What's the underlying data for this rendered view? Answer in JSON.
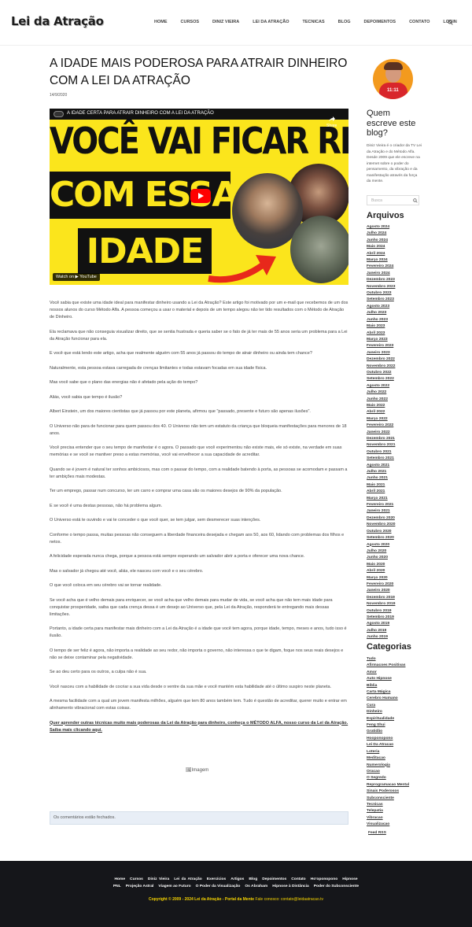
{
  "site": {
    "logo": "Lei da Atração"
  },
  "nav": {
    "items": [
      "HOME",
      "CURSOS",
      "DINIZ VIEIRA",
      "LEI DA ATRAÇÃO",
      "TECNICAS",
      "BLOG",
      "DEPOIMENTOS",
      "CONTATO",
      "LOGIN"
    ]
  },
  "post": {
    "title": "A IDADE MAIS PODEROSA PARA ATRAIR DINHEIRO COM A LEI DA ATRAÇÃO",
    "date": "14/9/2020",
    "video": {
      "title": "A IDADE CERTA PARA ATRAIR DINHEIRO COM A LEI DA ATRAÇÃO",
      "share": "Share",
      "line1": "VOCÊ VAI FICAR RICO",
      "line2": "COM ESSA",
      "line3": "IDADE",
      "watch": "Watch on ▶ YouTube"
    },
    "paragraphs": [
      "Você sabia que existe uma idade ideal para manifestar dinheiro usando a Lei da Atração? Este artigo foi motivado por um e-mail que recebemos de um dos nossos alunos do curso Método Alfa. A pessoa começou a usar o material e depois de um tempo alegou não ter tido resultados com o Método de Atração de Dinheiro.",
      "Ela reclamava que não conseguia visualizar direito, que se sentia frustrada e queria saber se o fato de já ter mais de 55 anos seria um problema para a Lei da Atração funcionar para ela.",
      "E você que está lendo este artigo, acha que realmente alguém com 55 anos já passou do tempo de atrair dinheiro ou ainda tem chance?",
      "Naturalmente, esta pessoa estava carregada de crenças limitantes e todas estavam focadas em sua idade física.",
      "Mas você sabe que o plano das energias não é afetado pela ação do tempo?",
      "Aliás, você sabia que tempo é ilusão?",
      "Albert Einstein, um dos maiores cientistas que já passou por este planeta, afirmou que \"passado, presente e futuro são apenas ilusões\".",
      "O Universo não para de funcionar para quem passou dos 40. O Universo não tem um estatuto da criança que bloqueia manifestações para menores de 18 anos.",
      "Você precisa entender que o seu tempo de manifestar é o agora. O passado que você experimentou não existe mais, ele só existe, na verdade em suas memórias e se você se mantiver preso a estas memórias, você vai envelhecer a sua capacidade de acreditar.",
      "Quando se é jovem é natural ter sonhos ambiciosos, mas com o passar do tempo, com a realidade batendo à porta, as pessoas se acomodam e passam a ter ambições mais modestas.",
      "Ter um emprego, passar num concurso, ter um carro e comprar uma casa são os maiores desejos de 90% da população.",
      "E se você é uma destas pessoas, não há problema algum.",
      "O Universo está te ouvindo e vai te conceder o que você quer, se tem julgar, sem desmerecer suas intenções.",
      "Conforme o tempo passa, muitas pessoas não conseguem a liberdade financeira desejada e chegam aos 50, aos 60, lidando com problemas dos filhos e netos.",
      "A felicidade esperada nunca chega, porque a pessoa está sempre esperando um salvador abrir a porta e oferecer uma nova chance.",
      "Mas o salvador já chegou até você, aliás, ele nasceu com você e o seu cérebro.",
      "O que você coloca em seu cérebro vai se tornar realidade.",
      "Se você acha que é velho demais para enriquecer, se você acha que velho demais para mudar de vida, se você acha que não tem mais idade para conquistar prosperidade, saiba que cada crença dessa é um desejo ao Universo que, pela Lei da Atração, responderá te entregando mais dessas limitações.",
      "Portanto, a idade certa para manifestar mais dinheiro com a Lei da Atração é a idade que você tem agora, porque idade, tempo, meses e anos, tudo isso é ilusão.",
      "O tempo de ser feliz é agora, não importa a realidade ao seu redor, não importa o governo, não interessa o que te digam, foque nos seus reais desejos e não se deixe contaminar pela negatividade.",
      "Se ao deu certo para os outros, a culpa não é sua.",
      "Você nasceu com a habilidade de cocriar a sua vida desde o ventre da sua mãe e você mantém esta habilidade até o último suspiro neste planeta.",
      "A mesma facilidade com a qual um jovem manifesta milhões, alguém que tem 80 anos também tem. Tudo é questão de acreditar, querer muito e entrar em alinhamento vibracional com estas coisas."
    ],
    "cta": "Quer aprender outras técnicas muito mais poderosas da Lei da Atração para dinheiro, conheça o MÉTODO ALFA, nosso curso da Lei da Atração. Saiba mais clicando aqui.",
    "image_alt": "Imagem",
    "comments_closed": "Os comentários estão fechados."
  },
  "sidebar": {
    "avatar_text": "11:11",
    "who_title": "Quem escreve este blog?",
    "who_desc": "Diniz Vieira é o criador da TV Lei da Atração e do Método Alfa. Desde 2009 que ele escreve na internet sobre o poder do pensamento, da vibração e da manifestação através da força da mente.",
    "search_placeholder": "Busca",
    "archives_title": "Arquivos",
    "archives": [
      "Agosto 2024",
      "Julho 2024",
      "Junho 2024",
      "Maio 2024",
      "Abril 2024",
      "Março 2024",
      "Fevereiro 2024",
      "Janeiro 2024",
      "Dezembro 2023",
      "Novembro 2023",
      "Outubro 2023",
      "Setembro 2023",
      "Agosto 2023",
      "Julho 2023",
      "Junho 2023",
      "Maio 2023",
      "Abril 2023",
      "Março 2023",
      "Fevereiro 2023",
      "Janeiro 2023",
      "Dezembro 2022",
      "Novembro 2022",
      "Outubro 2022",
      "Setembro 2022",
      "Agosto 2022",
      "Julho 2022",
      "Junho 2022",
      "Maio 2022",
      "Abril 2022",
      "Março 2022",
      "Fevereiro 2022",
      "Janeiro 2022",
      "Dezembro 2021",
      "Novembro 2021",
      "Outubro 2021",
      "Setembro 2021",
      "Agosto 2021",
      "Julho 2021",
      "Junho 2021",
      "Maio 2021",
      "Abril 2021",
      "Março 2021",
      "Fevereiro 2021",
      "Janeiro 2021",
      "Dezembro 2020",
      "Novembro 2020",
      "Outubro 2020",
      "Setembro 2020",
      "Agosto 2020",
      "Julho 2020",
      "Junho 2020",
      "Maio 2020",
      "Abril 2020",
      "Março 2020",
      "Fevereiro 2020",
      "Janeiro 2020",
      "Dezembro 2019",
      "Novembro 2019",
      "Outubro 2019",
      "Setembro 2019",
      "Agosto 2019",
      "Julho 2019",
      "Junho 2019"
    ],
    "categories_title": "Categorias",
    "categories": [
      "Tudo",
      "Afirmacoes Positivas",
      "Amor",
      "Auto Hipnose",
      "Bíblia",
      "Carta Mágica",
      "Cerebro Humano",
      "Cura",
      "Dinheiro",
      "Espiritualidade",
      "Feng Shui",
      "Gratidão",
      "Hooponopono",
      "Lei Da Atracao",
      "Loteria",
      "Meditacao",
      "Numerologia",
      "Oracao",
      "O Segredo",
      "Reprogramacao Mental",
      "Sinais Poderosos",
      "Subconsciente",
      "Tecnicas",
      "Telepatia",
      "Vibracao",
      "Visualizacao"
    ],
    "rss": "Feed RSS"
  },
  "footer": {
    "row1": [
      "Home",
      "Cursos",
      "Diniz Vieira",
      "Lei da Atração",
      "Exercícios",
      "Artigos",
      "Blog",
      "Depoimentos",
      "Contato",
      "Ho'oponopono",
      "Hipnose"
    ],
    "row2": [
      "PNL",
      "Projeção Astral",
      "Viagem ao Futuro",
      "O Poder da Visualização",
      "Os Abraham",
      "Hipnose à Distância",
      "Poder do Subconsciente"
    ],
    "copyright": "Copyright © 2009 - 2024 Lei da Atração - Portal da Mente",
    "contact": "Fale conosco: contato@leidaatracao.tv"
  }
}
